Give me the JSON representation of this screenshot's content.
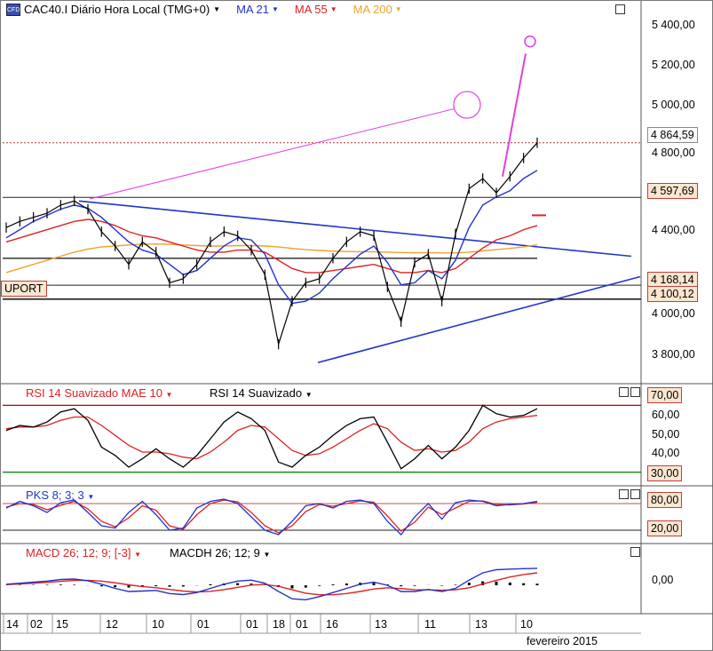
{
  "header": {
    "logo_text": "CFD",
    "instrument": "CAC40.I Diário Hora Local (TMG+0)",
    "legend": [
      {
        "label": "MA 21",
        "color": "#2233cc"
      },
      {
        "label": "MA 55",
        "color": "#dd2222"
      },
      {
        "label": "MA 200",
        "color": "#f0a030"
      }
    ]
  },
  "price_axis": {
    "ticks": [
      "5 400,00",
      "5 200,00",
      "5 000,00",
      "4 800,00",
      "4 400,00",
      "4 000,00",
      "3 800,00"
    ],
    "tags": [
      {
        "text": "4 864,59",
        "style": "plain"
      },
      {
        "text": "4 597,69",
        "style": "orange"
      },
      {
        "text": "4 168,14",
        "style": "orange"
      },
      {
        "text": "4 100,12",
        "style": "orange"
      }
    ],
    "support_label": "UPORT"
  },
  "rsi": {
    "legend_a": "RSI 14 Suavizado MAE 10",
    "legend_b": "RSI 14 Suavizado",
    "ticks": [
      "70,00",
      "60,00",
      "50,00",
      "40,00",
      "30,00"
    ]
  },
  "stoch": {
    "legend": "PKS 8; 3; 3",
    "ticks": [
      "80,00",
      "20,00"
    ]
  },
  "macd": {
    "legend_a": "MACD 26; 12; 9; [-3]",
    "legend_b": "MACDH 26; 12; 9",
    "ticks": [
      "0,00"
    ]
  },
  "x_axis": {
    "labels": [
      "14",
      "02",
      "15",
      "12",
      "10",
      "01",
      "01",
      "18",
      "01",
      "16",
      "13",
      "11",
      "13",
      "10"
    ],
    "month_label": "fevereiro 2015"
  },
  "chart_data": {
    "type": "line",
    "title": "CAC40.I Diário Hora Local (TMG+0)",
    "xlabel": "",
    "ylabel": "",
    "ylim": [
      3700,
      5480
    ],
    "series": [
      {
        "name": "CAC40.I",
        "values": [
          4450,
          4480,
          4500,
          4520,
          4560,
          4580,
          4540,
          4430,
          4360,
          4270,
          4380,
          4330,
          4180,
          4200,
          4270,
          4380,
          4430,
          4410,
          4340,
          4220,
          3880,
          4090,
          4180,
          4200,
          4300,
          4380,
          4430,
          4410,
          4160,
          3990,
          4280,
          4320,
          4090,
          4420,
          4640,
          4690,
          4620,
          4700,
          4790,
          4864.59
        ]
      },
      {
        "name": "MA 21",
        "values": [
          4400,
          4440,
          4480,
          4510,
          4540,
          4560,
          4545,
          4500,
          4440,
          4380,
          4340,
          4320,
          4270,
          4220,
          4240,
          4300,
          4360,
          4400,
          4390,
          4320,
          4170,
          4080,
          4090,
          4130,
          4200,
          4260,
          4320,
          4360,
          4280,
          4170,
          4180,
          4240,
          4200,
          4290,
          4450,
          4560,
          4600,
          4630,
          4690,
          4730
        ]
      },
      {
        "name": "MA 55",
        "values": [
          4380,
          4400,
          4420,
          4440,
          4460,
          4480,
          4490,
          4480,
          4460,
          4430,
          4410,
          4400,
          4380,
          4360,
          4340,
          4330,
          4330,
          4340,
          4340,
          4330,
          4290,
          4250,
          4230,
          4230,
          4240,
          4250,
          4260,
          4270,
          4250,
          4230,
          4230,
          4240,
          4230,
          4250,
          4300,
          4350,
          4390,
          4410,
          4440,
          4460
        ]
      },
      {
        "name": "MA 200",
        "values": [
          4230,
          4250,
          4270,
          4290,
          4310,
          4330,
          4345,
          4355,
          4360,
          4365,
          4368,
          4370,
          4368,
          4365,
          4362,
          4360,
          4360,
          4362,
          4362,
          4360,
          4355,
          4348,
          4342,
          4338,
          4335,
          4333,
          4332,
          4332,
          4330,
          4328,
          4327,
          4327,
          4326,
          4326,
          4330,
          4336,
          4342,
          4348,
          4356,
          4366
        ]
      }
    ],
    "rsi": {
      "ylim": [
        25,
        75
      ],
      "levels": [
        70,
        30
      ],
      "rsi_smoothed": [
        55,
        58,
        57,
        60,
        66,
        68,
        61,
        45,
        40,
        33,
        38,
        44,
        38,
        33,
        40,
        50,
        60,
        66,
        62,
        55,
        36,
        33,
        40,
        45,
        52,
        58,
        62,
        63,
        48,
        32,
        38,
        46,
        38,
        45,
        55,
        70,
        65,
        63,
        64,
        68
      ],
      "rsi_mae": [
        56,
        57,
        57,
        58,
        61,
        63,
        63,
        58,
        52,
        46,
        42,
        42,
        41,
        39,
        38,
        42,
        48,
        55,
        58,
        57,
        50,
        43,
        40,
        41,
        45,
        50,
        55,
        59,
        56,
        48,
        43,
        44,
        42,
        43,
        48,
        56,
        60,
        62,
        63,
        64
      ]
    },
    "stoch": {
      "ylim": [
        0,
        100
      ],
      "levels": [
        80,
        20
      ],
      "k": [
        70,
        85,
        75,
        60,
        82,
        88,
        60,
        30,
        25,
        60,
        85,
        55,
        20,
        25,
        70,
        85,
        90,
        80,
        50,
        20,
        10,
        40,
        75,
        80,
        70,
        85,
        88,
        80,
        40,
        10,
        50,
        80,
        45,
        82,
        88,
        85,
        75,
        78,
        80,
        85
      ],
      "d": [
        72,
        80,
        78,
        66,
        76,
        85,
        68,
        40,
        28,
        48,
        75,
        65,
        30,
        22,
        55,
        80,
        88,
        84,
        60,
        30,
        14,
        30,
        62,
        78,
        74,
        80,
        86,
        83,
        52,
        18,
        38,
        72,
        55,
        70,
        85,
        86,
        78,
        77,
        79,
        83
      ]
    },
    "macd": {
      "ylim": [
        -120,
        120
      ],
      "macd": [
        5,
        10,
        15,
        20,
        28,
        30,
        22,
        5,
        -15,
        -30,
        -28,
        -25,
        -40,
        -45,
        -35,
        -15,
        5,
        20,
        25,
        10,
        -30,
        -65,
        -70,
        -55,
        -35,
        -15,
        5,
        15,
        0,
        -30,
        -30,
        -20,
        -30,
        -15,
        25,
        60,
        75,
        78,
        80,
        82
      ],
      "signal": [
        3,
        6,
        10,
        14,
        19,
        23,
        24,
        20,
        12,
        2,
        -6,
        -12,
        -20,
        -28,
        -32,
        -29,
        -21,
        -10,
        1,
        4,
        -5,
        -22,
        -38,
        -46,
        -46,
        -40,
        -30,
        -18,
        -12,
        -16,
        -21,
        -22,
        -24,
        -22,
        -12,
        6,
        24,
        40,
        52,
        60
      ],
      "hist": [
        2,
        4,
        5,
        6,
        9,
        7,
        -2,
        -15,
        -27,
        -32,
        -22,
        -13,
        -20,
        -17,
        -3,
        14,
        26,
        30,
        24,
        6,
        -25,
        -43,
        -32,
        -9,
        11,
        25,
        35,
        33,
        12,
        -14,
        -9,
        2,
        -6,
        7,
        37,
        54,
        51,
        38,
        28,
        22
      ]
    }
  }
}
